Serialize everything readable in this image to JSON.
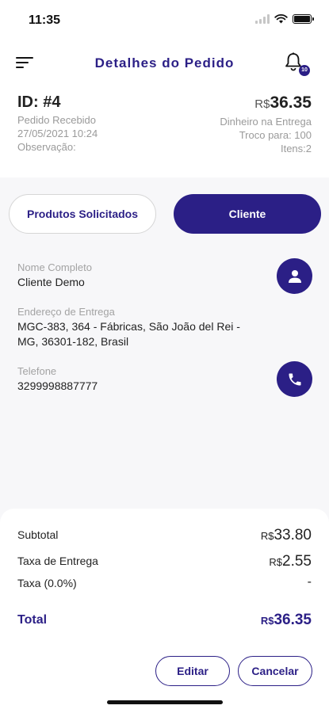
{
  "status_bar": {
    "time": "11:35"
  },
  "header": {
    "title": "Detalhes do Pedido",
    "notification_count": "10"
  },
  "order": {
    "id": "ID: #4",
    "status": "Pedido Recebido",
    "datetime": "27/05/2021 10:24",
    "observation_label": "Observação:",
    "currency": "R$",
    "total": "36.35",
    "payment_method": "Dinheiro na Entrega",
    "change_for": "Troco para: 100",
    "items": "Itens:2"
  },
  "tabs": {
    "products": "Produtos Solicitados",
    "client": "Cliente",
    "active": "client"
  },
  "client": {
    "name_label": "Nome Completo",
    "name": "Cliente Demo",
    "address_label": "Endereço de Entrega",
    "address_line1": "MGC-383, 364 - Fábricas, São João del Rei -",
    "address_line2": "MG, 36301-182, Brasil",
    "phone_label": "Telefone",
    "phone": "3299998887777"
  },
  "totals": {
    "currency": "R$",
    "subtotal_label": "Subtotal",
    "subtotal": "33.80",
    "delivery_label": "Taxa de Entrega",
    "delivery": "2.55",
    "tax_label": "Taxa (0.0%)",
    "tax": "-",
    "total_label": "Total",
    "total": "36.35"
  },
  "actions": {
    "edit": "Editar",
    "cancel": "Cancelar"
  },
  "colors": {
    "primary": "#2b1f86",
    "background": "#f7f7f9"
  }
}
